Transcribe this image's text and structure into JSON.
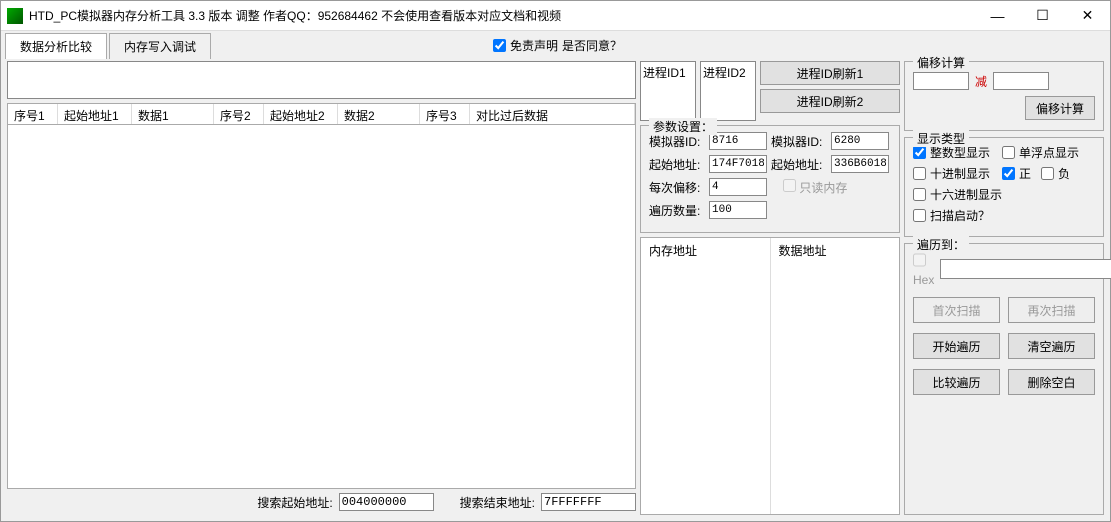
{
  "title": "HTD_PC模拟器内存分析工具   3.3 版本 调整 作者QQ：952684462 不会使用查看版本对应文档和视频",
  "tabs": [
    "数据分析比较",
    "内存写入调试"
  ],
  "disclaimer": {
    "checkbox_label": "免责声明",
    "question": "是否同意？"
  },
  "table_headers": [
    "序号1",
    "起始地址1",
    "数据1",
    "序号2",
    "起始地址2",
    "数据2",
    "序号3",
    "对比过后数据"
  ],
  "proc": {
    "id1_label": "进程ID1",
    "id2_label": "进程ID2",
    "refresh1": "进程ID刷新1",
    "refresh2": "进程ID刷新2"
  },
  "params": {
    "legend": "参数设置：",
    "sim_id_label": "模拟器ID:",
    "sim_id1": "8716",
    "sim_id2": "6280",
    "start_addr_label": "起始地址:",
    "start_addr1": "174F7018",
    "start_addr2": "336B6018",
    "offset_label": "每次偏移:",
    "offset_val": "4",
    "readonly_label": "只读内存",
    "iter_label": "遍历数量:",
    "iter_val": "100"
  },
  "mem_table": {
    "col1": "内存地址",
    "col2": "数据地址"
  },
  "bottom": {
    "start_label": "搜索起始地址:",
    "start_val": "004000000",
    "end_label": "搜索结束地址:",
    "end_val": "7FFFFFFF"
  },
  "offset": {
    "legend": "偏移计算",
    "minus": "减",
    "btn": "偏移计算"
  },
  "display": {
    "legend": "显示类型",
    "int_label": "整数型显示",
    "float_label": "单浮点显示",
    "dec_label": "十进制显示",
    "pos_label": "正",
    "neg_label": "负",
    "hex_label": "十六进制显示",
    "scan_start_label": "扫描启动？"
  },
  "traverse": {
    "legend": "遍历到：",
    "hex_label": "Hex"
  },
  "buttons": {
    "first_scan": "首次扫描",
    "rescan": "再次扫描",
    "start_trav": "开始遍历",
    "clear_trav": "清空遍历",
    "cmp_trav": "比较遍历",
    "del_blank": "删除空白"
  }
}
